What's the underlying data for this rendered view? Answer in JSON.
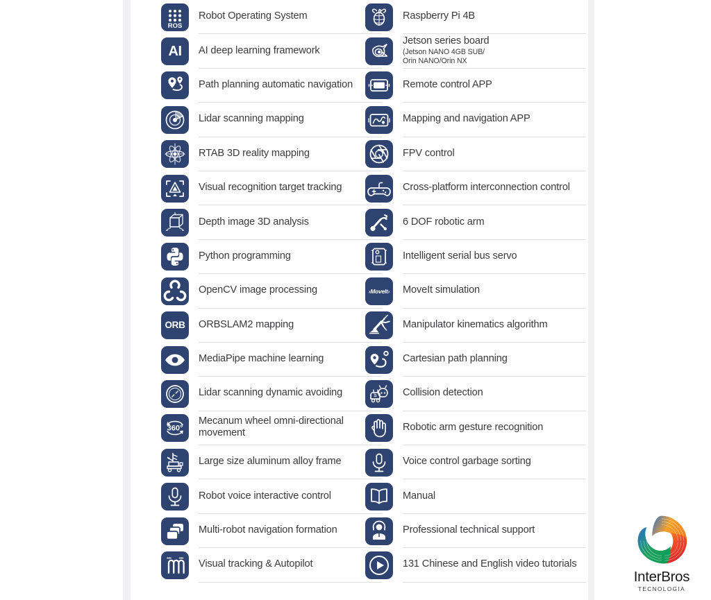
{
  "page": {
    "background_color": "#ffffff",
    "gutter_color": "#f1f1f3",
    "icon_badge_color": "#2e4370",
    "divider_color": "#dedee1",
    "label_color": "#3a3a3c"
  },
  "left_column": [
    {
      "icon": "ros-grid-icon",
      "label": "Robot Operating System"
    },
    {
      "icon": "ai-text-icon",
      "label": "AI deep learning framework"
    },
    {
      "icon": "map-pin-path-icon",
      "label": "Path planning automatic navigation"
    },
    {
      "icon": "lidar-radar-icon",
      "label": "Lidar scanning mapping"
    },
    {
      "icon": "rtab-point-cloud-icon",
      "label": "RTAB 3D reality mapping"
    },
    {
      "icon": "target-tracking-frame-icon",
      "label": "Visual recognition target tracking"
    },
    {
      "icon": "depth-cube-icon",
      "label": "Depth image 3D analysis"
    },
    {
      "icon": "python-logo-icon",
      "label": "Python programming"
    },
    {
      "icon": "opencv-logo-icon",
      "label": "OpenCV image processing"
    },
    {
      "icon": "orb-text-icon",
      "label": "ORBSLAM2 mapping"
    },
    {
      "icon": "eye-icon",
      "label": "MediaPipe machine learning"
    },
    {
      "icon": "compass-avoid-icon",
      "label": "Lidar scanning dynamic avoiding"
    },
    {
      "icon": "360-rotation-icon",
      "label": "Mecanum wheel omni-directional movement"
    },
    {
      "icon": "aluminum-frame-robot-icon",
      "label": "Large size aluminum alloy frame"
    },
    {
      "icon": "microphone-icon",
      "label": "Robot voice interactive control"
    },
    {
      "icon": "multi-robot-stack-icon",
      "label": "Multi-robot navigation formation"
    },
    {
      "icon": "serpentine-path-icon",
      "label": "Visual tracking & Autopilot"
    }
  ],
  "right_column": [
    {
      "icon": "raspberry-pi-logo-icon",
      "label": "Raspberry Pi 4B"
    },
    {
      "icon": "nvidia-jetson-logo-icon",
      "label": "Jetson series board",
      "sublabel": "(Jetson NANO 4GB SUB/\n Orin NANO/Orin NX"
    },
    {
      "icon": "tablet-remote-icon",
      "label": "Remote control APP"
    },
    {
      "icon": "map-screen-icon",
      "label": "Mapping and navigation APP"
    },
    {
      "icon": "camera-aperture-icon",
      "label": "FPV control"
    },
    {
      "icon": "gamepad-icon",
      "label": "Cross-platform interconnection control"
    },
    {
      "icon": "robotic-arm-icon",
      "label": "6 DOF robotic arm"
    },
    {
      "icon": "bus-servo-icon",
      "label": "Intelligent serial bus servo"
    },
    {
      "icon": "moveit-logo-icon",
      "label": "MoveIt simulation"
    },
    {
      "icon": "manipulator-kinematics-icon",
      "label": "Manipulator kinematics algorithm"
    },
    {
      "icon": "cartesian-path-icon",
      "label": "Cartesian path planning"
    },
    {
      "icon": "collision-detection-icon",
      "label": "Collision detection"
    },
    {
      "icon": "open-hand-icon",
      "label": "Robotic arm gesture recognition"
    },
    {
      "icon": "microphone-icon",
      "label": "Voice control garbage sorting"
    },
    {
      "icon": "open-book-icon",
      "label": "Manual"
    },
    {
      "icon": "headset-support-agent-icon",
      "label": "Professional technical support"
    },
    {
      "icon": "play-circle-icon",
      "label": "131 Chinese and English video tutorials"
    }
  ],
  "brand": {
    "name": "InterBros",
    "tagline": "TECNOLOGIA",
    "mark": "interbros-triangle-swirl-logo"
  }
}
